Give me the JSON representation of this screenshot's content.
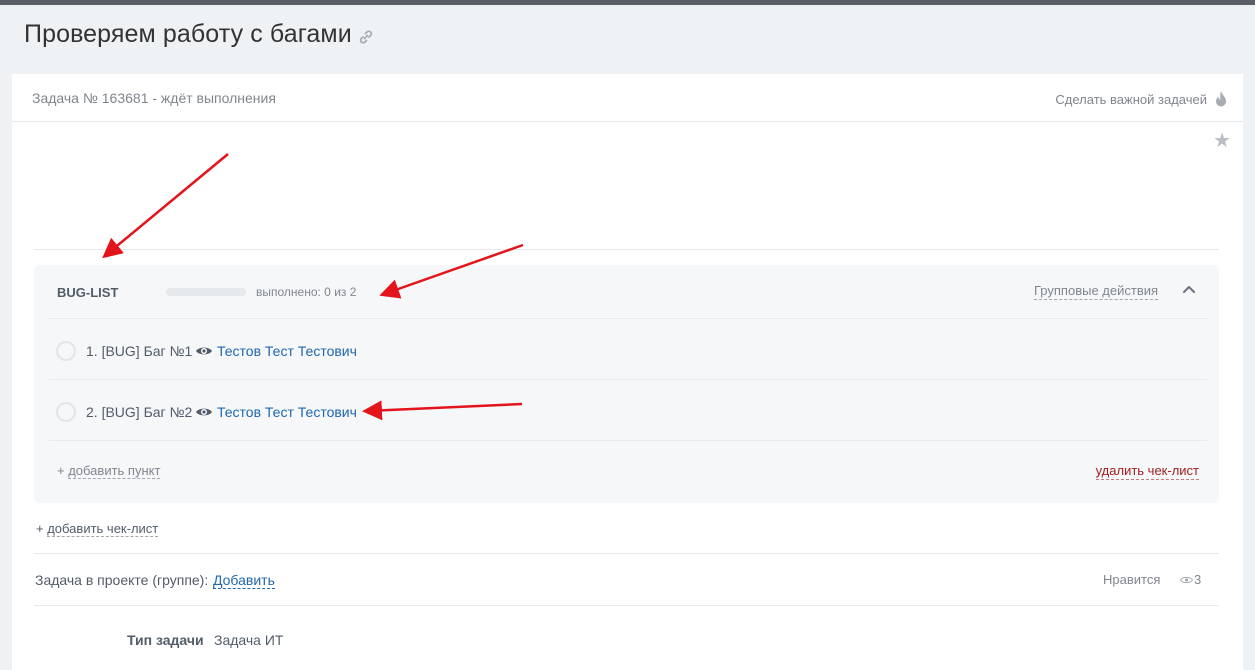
{
  "page": {
    "title": "Проверяем работу с багами"
  },
  "task": {
    "status_line": "Задача № 163681 - ждёт выполнения",
    "make_important": "Сделать важной задачей"
  },
  "checklist": {
    "title": "BUG-LIST",
    "progress_fraction": 0,
    "progress_text": "выполнено: 0 из 2",
    "group_actions": "Групповые действия",
    "items": [
      {
        "label": "1. [BUG] Баг №1",
        "assignee": "Тестов Тест Тестович"
      },
      {
        "label": "2. [BUG] Баг №2",
        "assignee": "Тестов Тест Тестович"
      }
    ],
    "add_item_plus": "+",
    "add_item": "добавить пункт",
    "delete": "удалить чек-лист"
  },
  "footer": {
    "add_checklist_plus": "+",
    "add_checklist": "добавить чек-лист",
    "project_label": "Задача в проекте (группе):",
    "project_link": "Добавить",
    "like": "Нравится",
    "views": "3",
    "type_label": "Тип задачи",
    "type_value": "Задача ИТ"
  },
  "colors": {
    "accent_link": "#2067b0",
    "delete_red": "#a12021",
    "annotation_arrow": "#e3141b"
  },
  "icons": [
    "link-icon",
    "fire-icon",
    "star-icon",
    "chevron-up-icon",
    "eye-icon",
    "views-eye-icon"
  ]
}
